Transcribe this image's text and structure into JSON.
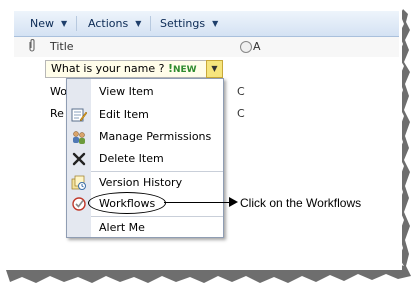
{
  "toolbar": {
    "new_label": "New",
    "actions_label": "Actions",
    "settings_label": "Settings"
  },
  "list": {
    "header_title": "Title",
    "header_next": "A",
    "selected_item": "What is your name ?",
    "selected_item_badge": "NEW",
    "row2_partial": "Wo",
    "row3_partial": "Re",
    "row2_col": "C",
    "row3_col": "C"
  },
  "menu": {
    "items": [
      {
        "label": "View Item",
        "icon": "none"
      },
      {
        "label": "Edit Item",
        "icon": "edit-icon"
      },
      {
        "label": "Manage Permissions",
        "icon": "permissions-icon"
      },
      {
        "label": "Delete Item",
        "icon": "delete-x-icon"
      },
      {
        "label": "Version History",
        "icon": "version-history-icon"
      },
      {
        "label": "Workflows",
        "icon": "workflows-icon"
      },
      {
        "label": "Alert Me",
        "icon": "none"
      }
    ]
  },
  "annotation": {
    "text": "Click on the Workflows"
  },
  "colors": {
    "toolbar_text": "#0b2a55",
    "toolbar_bg_top": "#eef4fb",
    "toolbar_bg_bottom": "#d4e2f3",
    "menu_gutter": "#e4e8f0",
    "new_badge": "#2e8b2e",
    "dropdown_button": "#f6e57d"
  }
}
